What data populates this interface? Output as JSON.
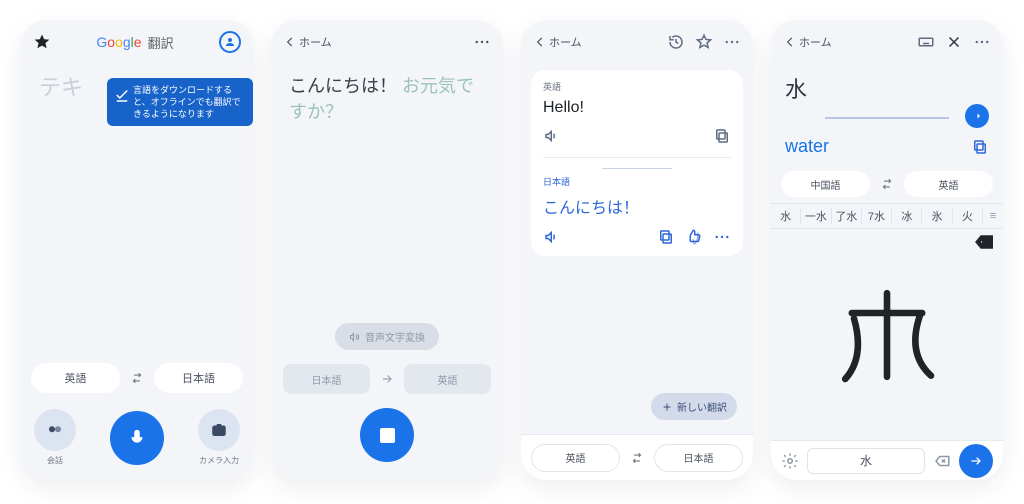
{
  "s1": {
    "app_title_suffix": "翻訳",
    "placeholder": "テキ",
    "tooltip": "言語をダウンロードすると、オフラインでも翻訳できるようになります",
    "lang_from": "英語",
    "lang_to": "日本語",
    "conv_label": "会話",
    "camera_label": "カメラ入力"
  },
  "s2": {
    "home": "ホーム",
    "entered": "こんにちは！",
    "suggestion": "お元気ですか？",
    "vtt": "音声文字変換",
    "lang_from": "日本語",
    "lang_to": "英語"
  },
  "s3": {
    "home": "ホーム",
    "src_lang": "英語",
    "src_text": "Hello!",
    "dst_lang": "日本語",
    "dst_text": "こんにちは！",
    "new": "新しい翻訳",
    "lang_from": "英語",
    "lang_to": "日本語"
  },
  "s4": {
    "home": "ホーム",
    "input": "水",
    "result": "water",
    "lang_from": "中国語",
    "lang_to": "英語",
    "candidates": [
      "水",
      "一水",
      "了水",
      "7水",
      "冰",
      "氷",
      "火"
    ],
    "spacebar": "水"
  }
}
